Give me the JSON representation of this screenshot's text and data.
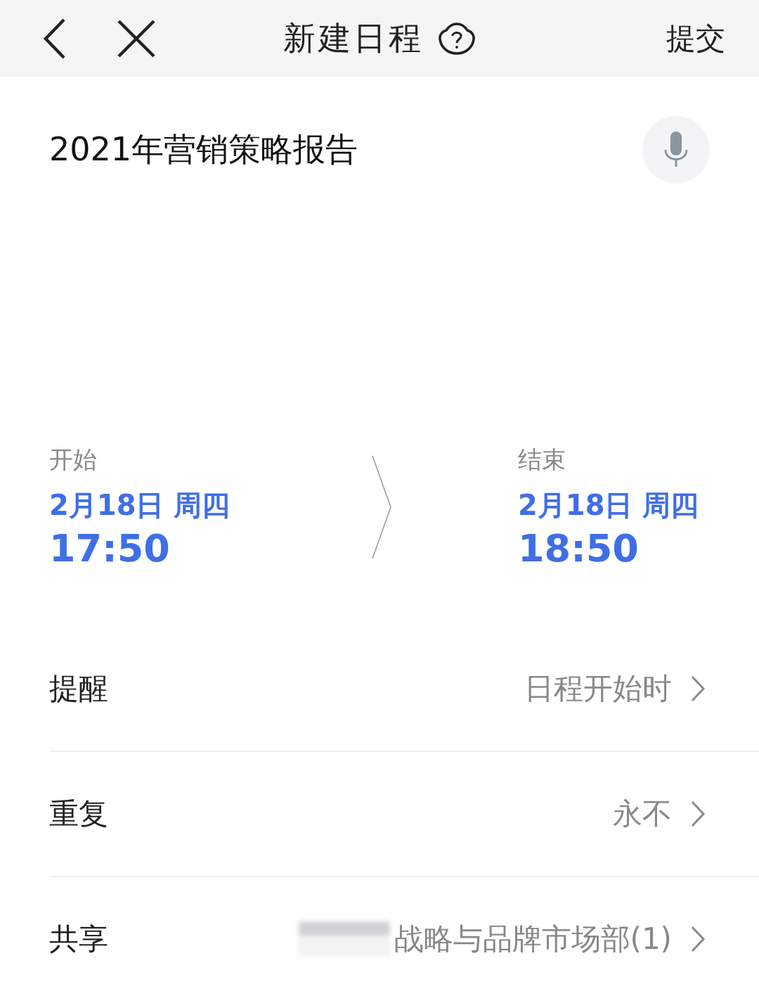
{
  "header": {
    "title": "新建日程",
    "submit": "提交"
  },
  "event_title": "2021年营销策略报告",
  "time": {
    "start": {
      "label": "开始",
      "date": "2月18日 周四",
      "time": "17:50"
    },
    "end": {
      "label": "结束",
      "date": "2月18日 周四",
      "time": "18:50"
    }
  },
  "settings": [
    {
      "label": "提醒",
      "value": "日程开始时",
      "redacted": false
    },
    {
      "label": "重复",
      "value": "永不",
      "redacted": false
    },
    {
      "label": "共享",
      "value": "战略与品牌市场部(1)",
      "redacted": true
    }
  ]
}
